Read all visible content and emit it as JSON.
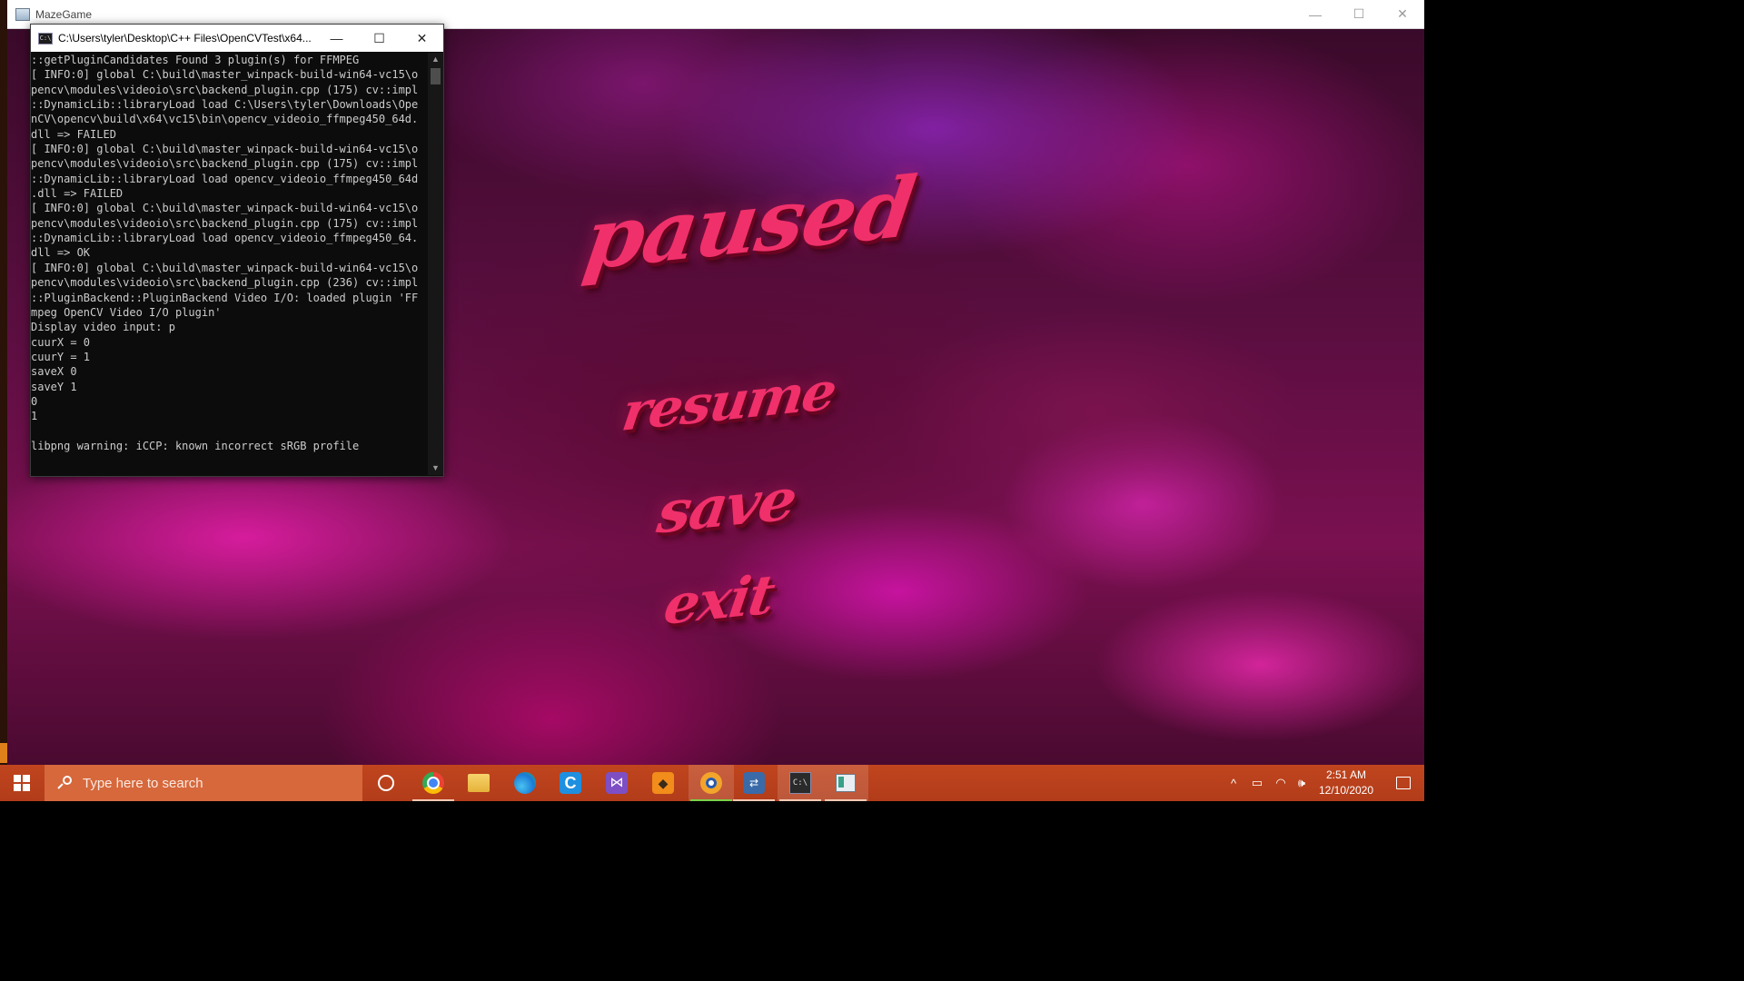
{
  "game_window": {
    "title": "MazeGame",
    "controls": {
      "minimize": "—",
      "maximize": "☐",
      "close": "✕"
    },
    "menu": {
      "title": "paused",
      "resume": "resume",
      "save": "save",
      "exit": "exit"
    },
    "accent_color": "#f0306a"
  },
  "console_window": {
    "title": "C:\\Users\\tyler\\Desktop\\C++ Files\\OpenCVTest\\x64...",
    "icon_text": "C:\\",
    "controls": {
      "minimize": "—",
      "maximize": "☐",
      "close": "✕"
    },
    "lines": [
      "::getPluginCandidates Found 3 plugin(s) for FFMPEG",
      "[ INFO:0] global C:\\build\\master_winpack-build-win64-vc15\\o",
      "pencv\\modules\\videoio\\src\\backend_plugin.cpp (175) cv::impl",
      "::DynamicLib::libraryLoad load C:\\Users\\tyler\\Downloads\\Ope",
      "nCV\\opencv\\build\\x64\\vc15\\bin\\opencv_videoio_ffmpeg450_64d.",
      "dll => FAILED",
      "[ INFO:0] global C:\\build\\master_winpack-build-win64-vc15\\o",
      "pencv\\modules\\videoio\\src\\backend_plugin.cpp (175) cv::impl",
      "::DynamicLib::libraryLoad load opencv_videoio_ffmpeg450_64d",
      ".dll => FAILED",
      "[ INFO:0] global C:\\build\\master_winpack-build-win64-vc15\\o",
      "pencv\\modules\\videoio\\src\\backend_plugin.cpp (175) cv::impl",
      "::DynamicLib::libraryLoad load opencv_videoio_ffmpeg450_64.",
      "dll => OK",
      "[ INFO:0] global C:\\build\\master_winpack-build-win64-vc15\\o",
      "pencv\\modules\\videoio\\src\\backend_plugin.cpp (236) cv::impl",
      "::PluginBackend::PluginBackend Video I/O: loaded plugin 'FF",
      "mpeg OpenCV Video I/O plugin'",
      "Display video input: p",
      "cuurX = 0",
      "cuurY = 1",
      "saveX 0",
      "saveY 1",
      "0",
      "1",
      "",
      "libpng warning: iCCP: known incorrect sRGB profile"
    ],
    "scroll": {
      "up": "▲",
      "down": "▼"
    }
  },
  "taskbar": {
    "search_placeholder": "Type here to search",
    "apps": [
      {
        "name": "cortana-button",
        "icon": "cortana-icon"
      },
      {
        "name": "taskbar-chrome",
        "icon": "chrome-icon"
      },
      {
        "name": "taskbar-file-explorer",
        "icon": "folder-icon"
      },
      {
        "name": "taskbar-edge",
        "icon": "edge-icon",
        "label": ""
      },
      {
        "name": "taskbar-ccleaner",
        "icon": "ccleaner-icon",
        "label": "C"
      },
      {
        "name": "taskbar-visual-studio",
        "icon": "visual-studio-icon",
        "label": "⋈"
      },
      {
        "name": "taskbar-sublime",
        "icon": "sublime-icon",
        "label": "◆"
      },
      {
        "name": "taskbar-obs",
        "icon": "obs-icon"
      },
      {
        "name": "taskbar-network-app",
        "icon": "network-icon",
        "label": "⇄"
      },
      {
        "name": "taskbar-command-prompt",
        "icon": "cmd-icon",
        "label": "C:\\"
      },
      {
        "name": "taskbar-mazegame",
        "icon": "mazegame-icon"
      }
    ],
    "tray": {
      "chevron": "^",
      "battery": "▭",
      "wifi": "◠",
      "volume": "🕪"
    },
    "clock": {
      "time": "2:51 AM",
      "date": "12/10/2020"
    },
    "colors": {
      "taskbar": "#b83f1b",
      "search": "#d6683c"
    }
  }
}
